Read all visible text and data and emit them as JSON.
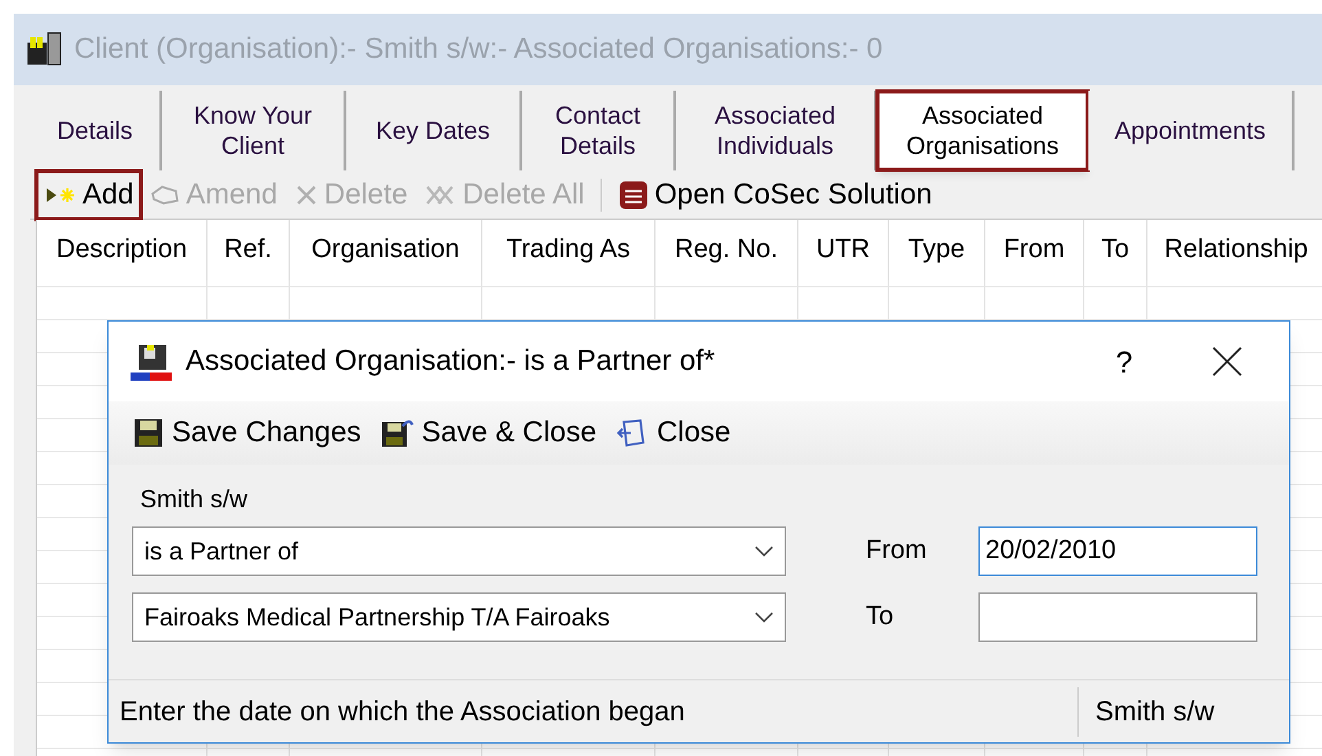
{
  "window": {
    "title": "Client (Organisation):- Smith s/w:- Associated Organisations:- 0"
  },
  "tabs": [
    {
      "label": "Details",
      "selected": false,
      "highlighted": false
    },
    {
      "label": "Know Your Client",
      "selected": false,
      "highlighted": false
    },
    {
      "label": "Key Dates",
      "selected": false,
      "highlighted": false
    },
    {
      "label": "Contact Details",
      "selected": false,
      "highlighted": false
    },
    {
      "label": "Associated Individuals",
      "selected": false,
      "highlighted": false
    },
    {
      "label": "Associated Organisations",
      "selected": true,
      "highlighted": true
    },
    {
      "label": "Appointments",
      "selected": false,
      "highlighted": false
    }
  ],
  "toolbar": [
    {
      "kind": "add",
      "label": "Add",
      "disabled": false,
      "highlighted": true
    },
    {
      "kind": "amend",
      "label": "Amend",
      "disabled": true,
      "highlighted": false
    },
    {
      "kind": "delete",
      "label": "Delete",
      "disabled": true,
      "highlighted": false
    },
    {
      "kind": "delete_all",
      "label": "Delete All",
      "disabled": true,
      "highlighted": false
    },
    {
      "kind": "cosec",
      "label": "Open CoSec Solution",
      "disabled": false,
      "highlighted": false
    }
  ],
  "table": {
    "columns": [
      "Description",
      "Ref.",
      "Organisation",
      "Trading As",
      "Reg. No.",
      "UTR",
      "Type",
      "From",
      "To",
      "Relationship"
    ]
  },
  "dialog": {
    "title": "Associated Organisation:- is a Partner of*",
    "help": "?",
    "toolbar": [
      {
        "kind": "save",
        "label": "Save Changes"
      },
      {
        "kind": "save_close",
        "label": "Save & Close"
      },
      {
        "kind": "close",
        "label": "Close"
      }
    ],
    "client_label": "Smith s/w",
    "relationship": "is a Partner of",
    "organisation": "Fairoaks Medical Partnership T/A Fairoaks",
    "from": {
      "label": "From",
      "value": "20/02/2010",
      "focused": true
    },
    "to": {
      "label": "To",
      "focused": false
    },
    "status_bar": [
      "Enter the date on which the Association began",
      "Smith s/w"
    ]
  }
}
